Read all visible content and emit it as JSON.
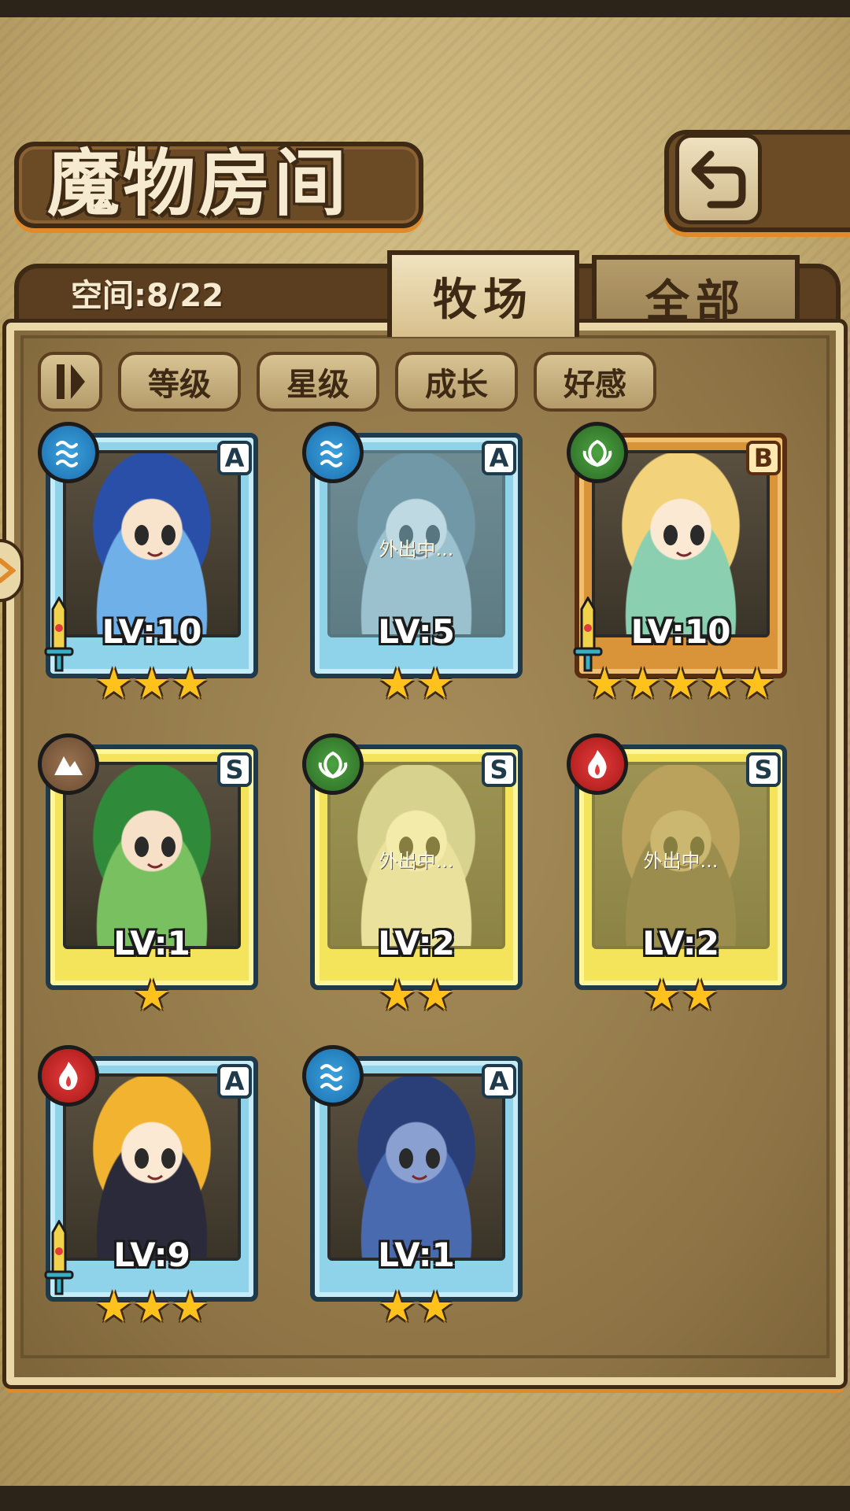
{
  "header": {
    "title": "魔物房间",
    "back_icon": "return-arrow-icon"
  },
  "panel": {
    "space_label": "空间:8/22",
    "tabs": [
      {
        "label": "牧场",
        "active": true
      },
      {
        "label": "全部",
        "active": false
      }
    ],
    "sort_buttons": [
      "等级",
      "星级",
      "成长",
      "好感"
    ]
  },
  "monsters": [
    {
      "element": "water",
      "rank": "A",
      "level": "LV:10",
      "stars": 3,
      "away": "",
      "weapon": true
    },
    {
      "element": "water",
      "rank": "A",
      "level": "LV:5",
      "stars": 2,
      "away": "外出中...",
      "weapon": false
    },
    {
      "element": "wood",
      "rank": "B",
      "level": "LV:10",
      "stars": 5,
      "away": "",
      "weapon": true
    },
    {
      "element": "earth",
      "rank": "S",
      "level": "LV:1",
      "stars": 1,
      "away": "",
      "weapon": false
    },
    {
      "element": "wood",
      "rank": "S",
      "level": "LV:2",
      "stars": 2,
      "away": "外出中...",
      "weapon": false
    },
    {
      "element": "fire",
      "rank": "S",
      "level": "LV:2",
      "stars": 2,
      "away": "外出中...",
      "weapon": false
    },
    {
      "element": "fire",
      "rank": "A",
      "level": "LV:9",
      "stars": 3,
      "away": "",
      "weapon": true
    },
    {
      "element": "water",
      "rank": "A",
      "level": "LV:1",
      "stars": 2,
      "away": "",
      "weapon": false
    }
  ],
  "colors": {
    "rank_a": "#8fd3ea",
    "rank_s": "#f4e45c",
    "rank_b": "#d9943a",
    "star": "#ffc21c",
    "accent_orange": "#e08a2a"
  }
}
